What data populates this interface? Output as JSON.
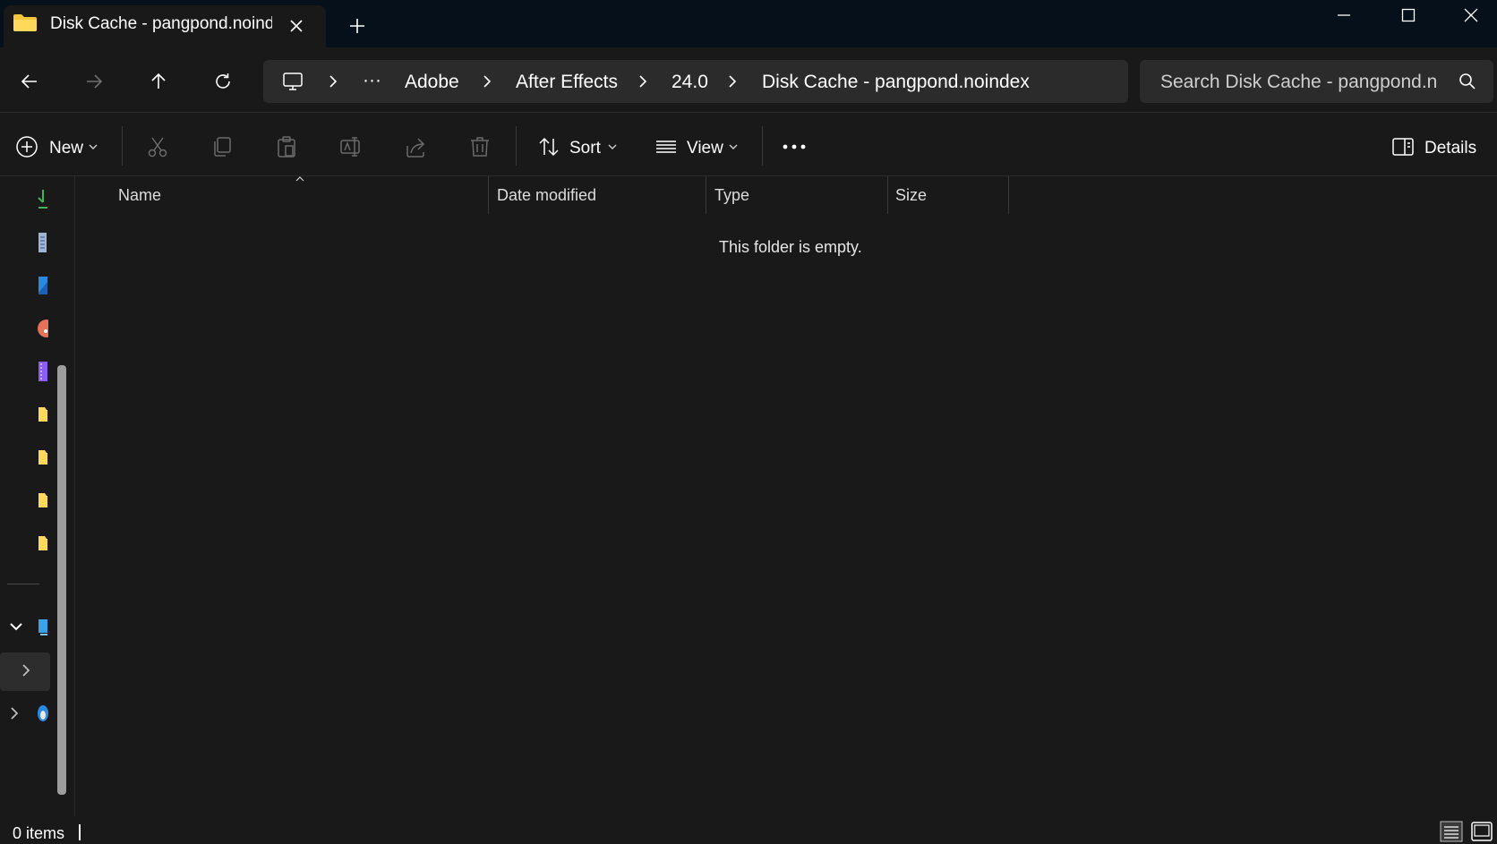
{
  "window": {
    "tab_title": "Disk Cache - pangpond.noindex",
    "colors": {
      "titlebar": "#05101b",
      "background": "#191919",
      "accent": "#f3c53a"
    }
  },
  "address": {
    "crumbs": [
      "Adobe",
      "After Effects",
      "24.0",
      "Disk Cache - pangpond.noindex"
    ],
    "overflow": "···"
  },
  "search": {
    "placeholder": "Search Disk Cache - pangpond.noindex"
  },
  "commands": {
    "new_label": "New",
    "sort_label": "Sort",
    "view_label": "View",
    "details_label": "Details"
  },
  "columns": [
    "Name",
    "Date modified",
    "Type",
    "Size"
  ],
  "content": {
    "empty_message": "This folder is empty."
  },
  "status": {
    "items": "0 items"
  },
  "sidebar_icons": [
    "downloads-icon",
    "documents-icon",
    "pictures-icon",
    "music-icon",
    "videos-icon",
    "folder-icon",
    "folder-icon",
    "folder-icon",
    "folder-icon",
    "this-pc-icon",
    "network-icon",
    "linux-icon"
  ]
}
